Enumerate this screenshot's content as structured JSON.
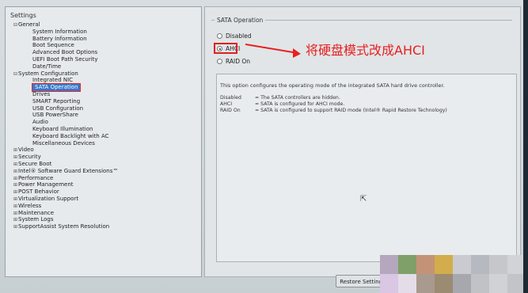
{
  "settings_title": "Settings",
  "tree": [
    {
      "label": "General",
      "level": 0,
      "expander": "⊟"
    },
    {
      "label": "System Information",
      "level": 1
    },
    {
      "label": "Battery Information",
      "level": 1
    },
    {
      "label": "Boot Sequence",
      "level": 1
    },
    {
      "label": "Advanced Boot Options",
      "level": 1
    },
    {
      "label": "UEFI Boot Path Security",
      "level": 1
    },
    {
      "label": "Date/Time",
      "level": 1
    },
    {
      "label": "System Configuration",
      "level": 0,
      "expander": "⊟"
    },
    {
      "label": "Integrated NIC",
      "level": 1
    },
    {
      "label": "SATA Operation",
      "level": 1,
      "selected": true
    },
    {
      "label": "Drives",
      "level": 1
    },
    {
      "label": "SMART Reporting",
      "level": 1
    },
    {
      "label": "USB Configuration",
      "level": 1
    },
    {
      "label": "USB PowerShare",
      "level": 1
    },
    {
      "label": "Audio",
      "level": 1
    },
    {
      "label": "Keyboard Illumination",
      "level": 1
    },
    {
      "label": "Keyboard Backlight with AC",
      "level": 1
    },
    {
      "label": "Miscellaneous Devices",
      "level": 1
    },
    {
      "label": "Video",
      "level": 0,
      "expander": "⊞"
    },
    {
      "label": "Security",
      "level": 0,
      "expander": "⊞"
    },
    {
      "label": "Secure Boot",
      "level": 0,
      "expander": "⊞"
    },
    {
      "label": "Intel® Software Guard Extensions™",
      "level": 0,
      "expander": "⊞"
    },
    {
      "label": "Performance",
      "level": 0,
      "expander": "⊞"
    },
    {
      "label": "Power Management",
      "level": 0,
      "expander": "⊞"
    },
    {
      "label": "POST Behavior",
      "level": 0,
      "expander": "⊞"
    },
    {
      "label": "Virtualization Support",
      "level": 0,
      "expander": "⊞"
    },
    {
      "label": "Wireless",
      "level": 0,
      "expander": "⊞"
    },
    {
      "label": "Maintenance",
      "level": 0,
      "expander": "⊞"
    },
    {
      "label": "System Logs",
      "level": 0,
      "expander": "⊞"
    },
    {
      "label": "SupportAssist System Resolution",
      "level": 0,
      "expander": "⊞"
    }
  ],
  "sata": {
    "group_title": "SATA Operation",
    "options": [
      {
        "label": "Disabled",
        "checked": false
      },
      {
        "label": "AHCI",
        "checked": true
      },
      {
        "label": "RAID On",
        "checked": false
      }
    ]
  },
  "annotation": "将硬盘模式改成AHCI",
  "description": {
    "main": "This option configures the operating mode of the integrated SATA hard drive controller.",
    "rows": [
      {
        "key": "Disabled",
        "text": "= The SATA controllers are hidden."
      },
      {
        "key": "AHCI",
        "text": "= SATA is configured for AHCI mode."
      },
      {
        "key": "RAID On",
        "text": "= SATA is configured to support RAID mode (Intel® Rapid Restore Technology)"
      }
    ]
  },
  "buttons": {
    "restore": "Restore Settings"
  },
  "colors": {
    "annotation": "#e82020",
    "selection": "#3a78c9",
    "highlight_border": "#e02020"
  }
}
